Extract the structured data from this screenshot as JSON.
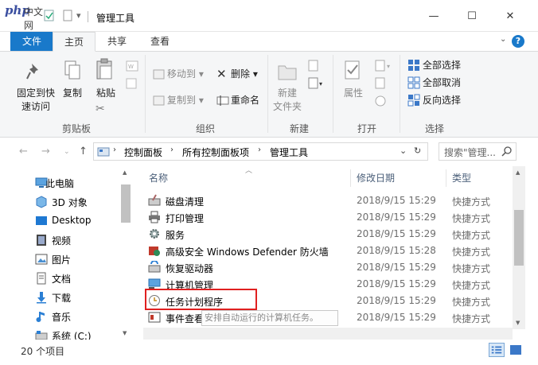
{
  "watermark": {
    "latin": "php",
    "cn": "中文网"
  },
  "window": {
    "title": "管理工具",
    "minimize": "—",
    "maximize": "☐",
    "close": "✕"
  },
  "tabs": [
    {
      "label": "文件"
    },
    {
      "label": "主页"
    },
    {
      "label": "共享"
    },
    {
      "label": "查看"
    }
  ],
  "help": "?",
  "ribbon": {
    "clipboard": {
      "label": "剪贴板",
      "pin": "固定到快\n速访问",
      "copy": "复制",
      "paste": "粘贴"
    },
    "organize": {
      "label": "组织",
      "move_to": "移动到",
      "copy_to": "复制到",
      "delete": "删除",
      "rename": "重命名"
    },
    "new": {
      "label": "新建",
      "new_folder": "新建\n文件夹"
    },
    "open": {
      "label": "打开",
      "properties": "属性"
    },
    "select": {
      "label": "选择",
      "select_all": "全部选择",
      "select_none": "全部取消",
      "invert": "反向选择"
    }
  },
  "address": {
    "breadcrumbs": [
      "控制面板",
      "所有控制面板项",
      "管理工具"
    ],
    "search_placeholder": "搜索\"管理..."
  },
  "navigation": [
    {
      "label": "此电脑",
      "icon": "computer-icon"
    },
    {
      "label": "3D 对象",
      "icon": "3d-objects-icon"
    },
    {
      "label": "Desktop",
      "icon": "desktop-icon"
    },
    {
      "label": "视频",
      "icon": "video-icon"
    },
    {
      "label": "图片",
      "icon": "pictures-icon"
    },
    {
      "label": "文档",
      "icon": "documents-icon"
    },
    {
      "label": "下载",
      "icon": "download-icon"
    },
    {
      "label": "音乐",
      "icon": "music-icon"
    },
    {
      "label": "系统 (C:)",
      "icon": "drive-icon"
    }
  ],
  "columns": {
    "name": "名称",
    "date": "修改日期",
    "type": "类型"
  },
  "files": [
    {
      "name": "磁盘清理",
      "date": "2018/9/15 15:29",
      "type": "快捷方式",
      "icon": "disk-cleanup-icon"
    },
    {
      "name": "打印管理",
      "date": "2018/9/15 15:29",
      "type": "快捷方式",
      "icon": "printer-icon"
    },
    {
      "name": "服务",
      "date": "2018/9/15 15:29",
      "type": "快捷方式",
      "icon": "services-icon"
    },
    {
      "name": "高级安全 Windows Defender 防火墙",
      "date": "2018/9/15 15:28",
      "type": "快捷方式",
      "icon": "firewall-icon"
    },
    {
      "name": "恢复驱动器",
      "date": "2018/9/15 15:29",
      "type": "快捷方式",
      "icon": "recovery-drive-icon"
    },
    {
      "name": "计算机管理",
      "date": "2018/9/15 15:29",
      "type": "快捷方式",
      "icon": "computer-management-icon"
    },
    {
      "name": "任务计划程序",
      "date": "2018/9/15 15:29",
      "type": "快捷方式",
      "icon": "task-scheduler-icon"
    },
    {
      "name": "事件查看器",
      "date": "2018/9/15 15:29",
      "type": "快捷方式",
      "icon": "event-viewer-icon"
    }
  ],
  "tooltip": "安排自动运行的计算机任务。",
  "status": {
    "item_count": "20 个项目"
  },
  "colors": {
    "accent": "#1979ca",
    "highlight_border": "#e02020"
  }
}
